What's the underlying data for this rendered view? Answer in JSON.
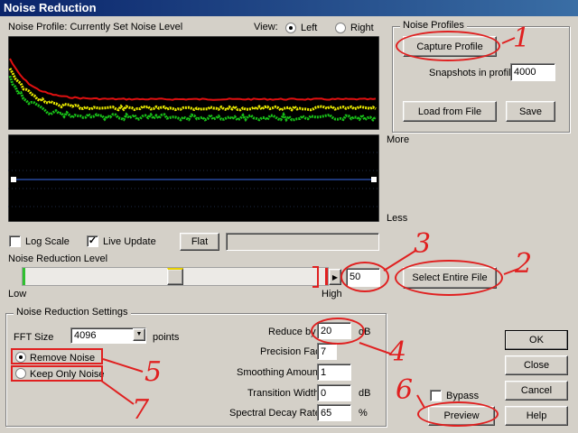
{
  "window": {
    "title": "Noise Reduction"
  },
  "profile_header": {
    "label": "Noise Profile: Currently Set Noise Level",
    "view_label": "View:",
    "view_options": [
      {
        "label": "Left",
        "selected": true
      },
      {
        "label": "Right",
        "selected": false
      }
    ]
  },
  "noise_profiles": {
    "group_label": "Noise Profiles",
    "capture_button": "Capture Profile",
    "snapshots_label": "Snapshots in profile",
    "snapshots_value": "4000",
    "load_button": "Load from File",
    "save_button": "Save"
  },
  "graph": {
    "more_label": "More",
    "less_label": "Less"
  },
  "options": {
    "log_scale_label": "Log Scale",
    "log_scale_checked": false,
    "live_update_label": "Live Update",
    "live_update_checked": true,
    "flat_button": "Flat"
  },
  "reduction_level": {
    "label": "Noise Reduction Level",
    "low_label": "Low",
    "high_label": "High",
    "value": "50",
    "level_fraction": 0.5,
    "select_entire_button": "Select Entire File"
  },
  "settings": {
    "group_label": "Noise Reduction Settings",
    "fft_label": "FFT Size",
    "fft_value": "4096",
    "fft_unit": "points",
    "remove_noise_label": "Remove Noise",
    "remove_noise_selected": true,
    "keep_noise_label": "Keep Only Noise",
    "keep_noise_selected": false,
    "reduce_label": "Reduce by",
    "reduce_value": "20",
    "reduce_unit": "dB",
    "precision_label": "Precision Factor",
    "precision_value": "7",
    "smoothing_label": "Smoothing Amount",
    "smoothing_value": "1",
    "transition_label": "Transition Width",
    "transition_value": "0",
    "transition_unit": "dB",
    "decay_label": "Spectral Decay Rate",
    "decay_value": "65",
    "decay_unit": "%"
  },
  "actions": {
    "ok": "OK",
    "close": "Close",
    "cancel": "Cancel",
    "help": "Help",
    "bypass_label": "Bypass",
    "bypass_checked": false,
    "preview": "Preview"
  },
  "annotations": [
    "1",
    "2",
    "3",
    "4",
    "5",
    "6",
    "7"
  ],
  "colors": {
    "title_bar": "#0a246a",
    "annotation": "#e02020",
    "graph_bg": "#000000"
  }
}
